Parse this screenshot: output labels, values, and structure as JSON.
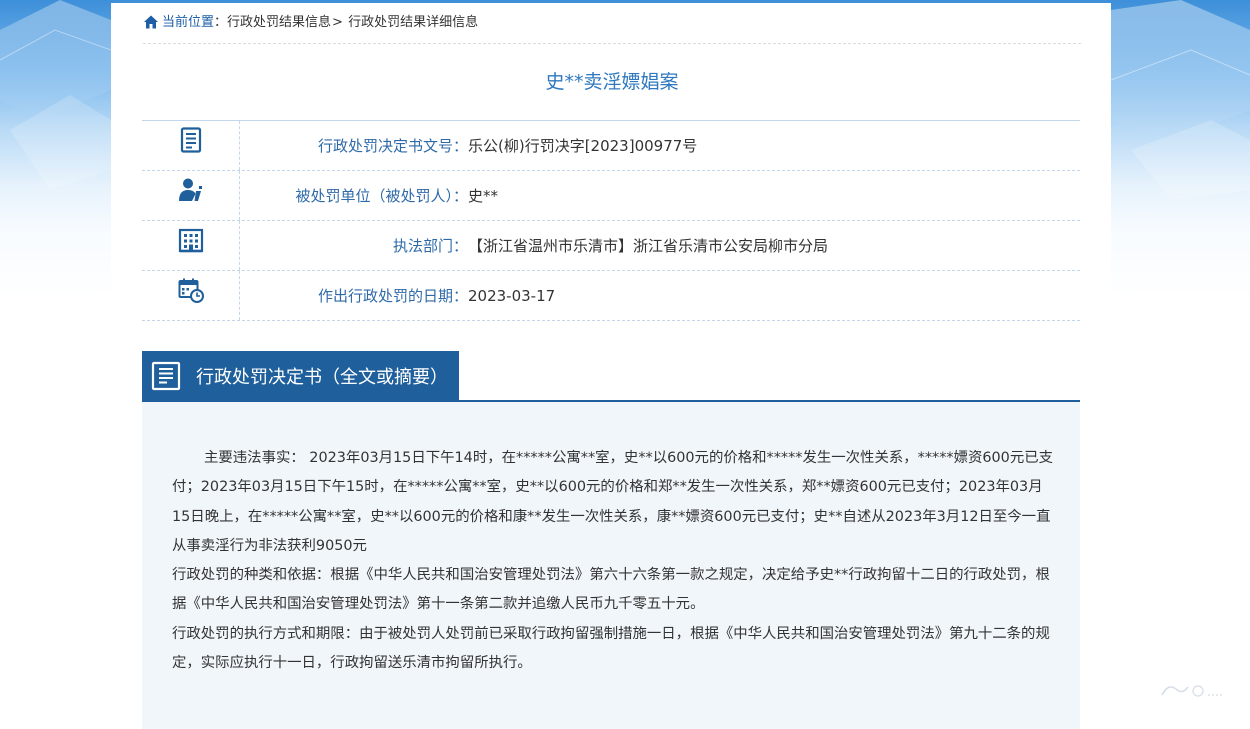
{
  "breadcrumb": {
    "current_label": "当前位置",
    "colon": "：",
    "level1": "行政处罚结果信息",
    "sep": ">",
    "level2": "行政处罚结果详细信息"
  },
  "title": "史**卖淫嫖娼案",
  "info": [
    {
      "icon": "document-number-icon",
      "label": "行政处罚决定书文号：",
      "value": "乐公(柳)行罚决字[2023]00977号"
    },
    {
      "icon": "person-icon",
      "label": "被处罚单位（被处罚人）：",
      "value": "史**"
    },
    {
      "icon": "building-icon",
      "label": "执法部门：",
      "value": "【浙江省温州市乐清市】浙江省乐清市公安局柳市分局"
    },
    {
      "icon": "calendar-clock-icon",
      "label": "作出行政处罚的日期：",
      "value": "2023-03-17"
    }
  ],
  "section": {
    "title": "行政处罚决定书（全文或摘要）"
  },
  "content": {
    "p1": "主要违法事实： 2023年03月15日下午14时，在*****公寓**室，史**以600元的价格和*****发生一次性关系，*****嫖资600元已支付；2023年03月15日下午15时，在*****公寓**室，史**以600元的价格和郑**发生一次性关系，郑**嫖资600元已支付；2023年03月15日晚上，在*****公寓**室，史**以600元的价格和康**发生一次性关系，康**嫖资600元已支付；史**自述从2023年3月12日至今一直从事卖淫行为非法获利9050元",
    "p2": "行政处罚的种类和依据：根据《中华人民共和国治安管理处罚法》第六十六条第一款之规定，决定给予史**行政拘留十二日的行政处罚，根据《中华人民共和国治安管理处罚法》第十一条第二款并追缴人民币九千零五十元。",
    "p3": "行政处罚的执行方式和期限：由于被处罚人处罚前已采取行政拘留强制措施一日，根据《中华人民共和国治安管理处罚法》第九十二条的规定，实际应执行十一日，行政拘留送乐清市拘留所执行。"
  },
  "colors": {
    "accent": "#1f5f9b",
    "label": "#2f6aa8",
    "title": "#2f78c0",
    "content_bg": "#f1f6fb"
  }
}
